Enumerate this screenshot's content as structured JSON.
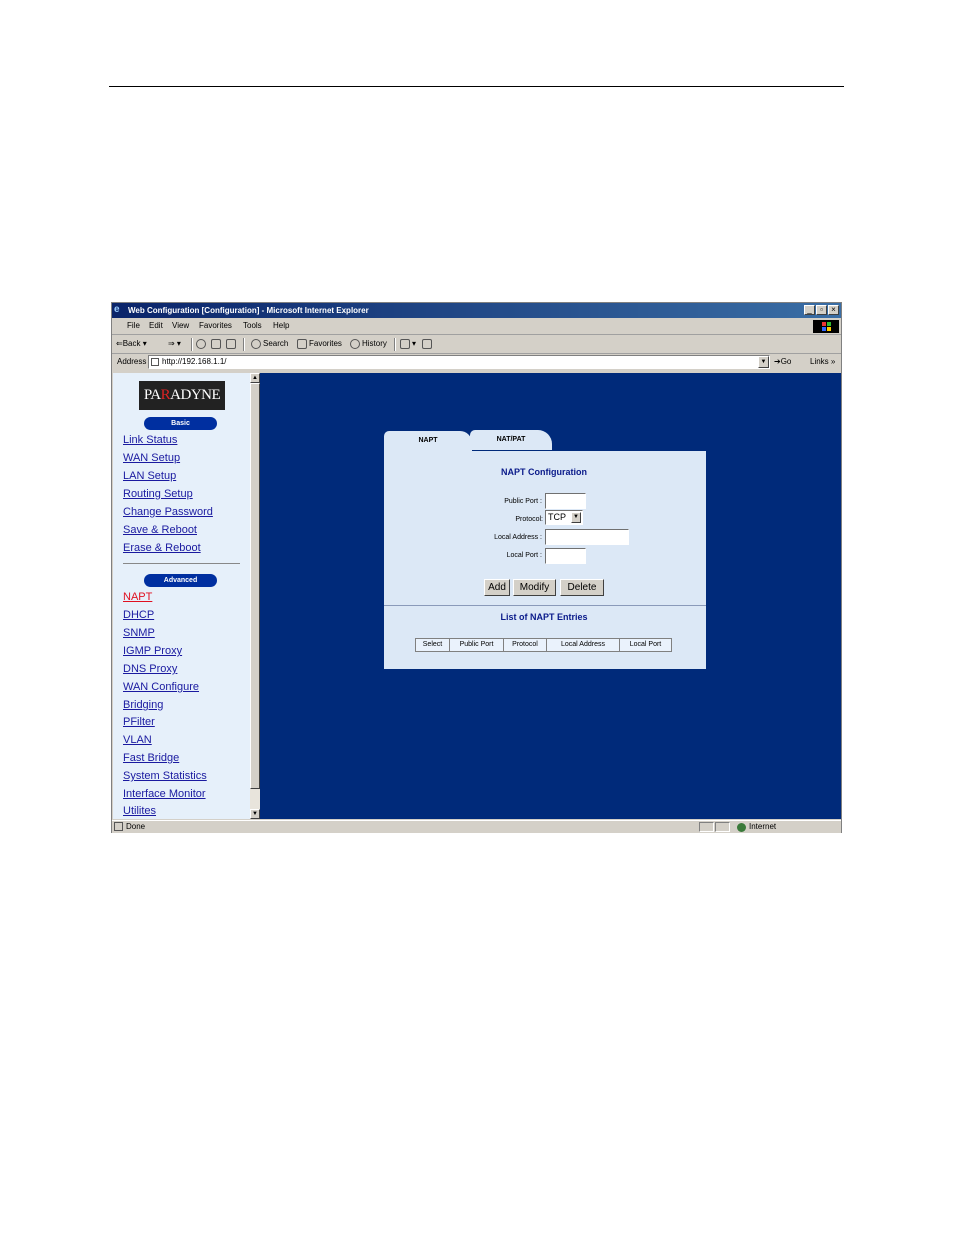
{
  "window": {
    "title": "Web Configuration [Configuration] - Microsoft Internet Explorer",
    "controls": [
      "_",
      "▫",
      "×"
    ]
  },
  "menubar": [
    "File",
    "Edit",
    "View",
    "Favorites",
    "Tools",
    "Help"
  ],
  "toolbar": {
    "back": "Back",
    "search": "Search",
    "favorites": "Favorites",
    "history": "History"
  },
  "address": {
    "label": "Address",
    "url": "http://192.168.1.1/",
    "go": "Go",
    "links": "Links »"
  },
  "sidebar": {
    "logo_left": "PA",
    "logo_red": "R",
    "logo_right": "ADYNE",
    "basic_label": "Basic",
    "basic_links": [
      "Link Status",
      "WAN Setup",
      "LAN Setup",
      "Routing Setup",
      "Change Password",
      "Save & Reboot",
      "Erase & Reboot"
    ],
    "advanced_label": "Advanced",
    "advanced_links": [
      "NAPT",
      "DHCP",
      "SNMP",
      "IGMP Proxy",
      "DNS Proxy",
      "WAN Configure",
      "Bridging",
      "PFilter",
      "VLAN",
      "Fast Bridge",
      "System Statistics",
      "Interface Monitor",
      "Utilites"
    ],
    "active": "NAPT"
  },
  "tabs": [
    "NAPT",
    "NAT/PAT"
  ],
  "form": {
    "title": "NAPT Configuration",
    "public_port_label": "Public Port :",
    "protocol_label": "Protocol:",
    "protocol_value": "TCP",
    "local_address_label": "Local Address :",
    "local_port_label": "Local Port :",
    "buttons": [
      "Add",
      "Modify",
      "Delete"
    ]
  },
  "entries": {
    "title": "List of NAPT Entries",
    "columns": [
      "Select",
      "Public Port",
      "Protocol",
      "Local Address",
      "Local Port"
    ]
  },
  "status": {
    "text": "Done",
    "zone": "Internet"
  },
  "colors": {
    "main_bg": "#002a7a",
    "sidebar_bg": "#e6f0fa",
    "panel_bg": "#dce8f6",
    "active_link": "#e01020"
  }
}
